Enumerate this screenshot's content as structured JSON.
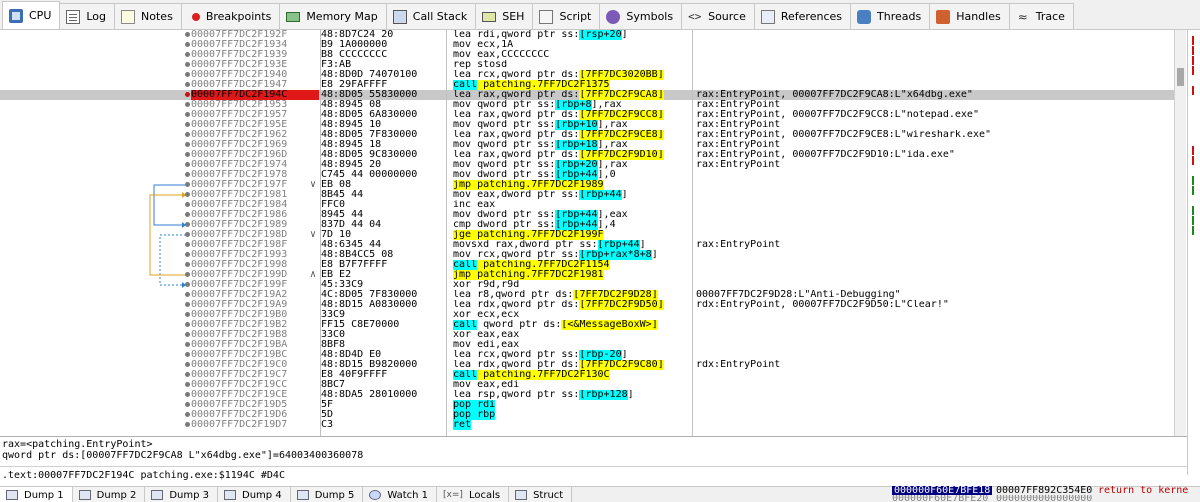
{
  "top_tabs": [
    {
      "label": "CPU",
      "icon": "cpu-icon"
    },
    {
      "label": "Log",
      "icon": "log-icon"
    },
    {
      "label": "Notes",
      "icon": "notes-icon"
    },
    {
      "label": "Breakpoints",
      "icon": "breakpoint-dot-icon"
    },
    {
      "label": "Memory Map",
      "icon": "memory-map-icon"
    },
    {
      "label": "Call Stack",
      "icon": "call-stack-icon"
    },
    {
      "label": "SEH",
      "icon": "seh-icon"
    },
    {
      "label": "Script",
      "icon": "script-icon"
    },
    {
      "label": "Symbols",
      "icon": "symbols-icon"
    },
    {
      "label": "Source",
      "icon": "source-icon"
    },
    {
      "label": "References",
      "icon": "references-icon"
    },
    {
      "label": "Threads",
      "icon": "threads-icon"
    },
    {
      "label": "Handles",
      "icon": "handles-icon"
    },
    {
      "label": "Trace",
      "icon": "trace-icon"
    }
  ],
  "active_top_tab": "CPU",
  "colors": {
    "breakpoint": "#e01818",
    "highlight_call_jump": "#ffff00",
    "highlight_memory": "#00ffff",
    "selected_row": "#c8c8c8",
    "stack_selected": "#000080",
    "return_text": "#c00000"
  },
  "disasm_rows": [
    {
      "addr": "00007FF7DC2F192F",
      "bytes": "48:8D7C24 20",
      "arrow": "",
      "instr": [
        [
          "lea rdi,qword ptr ss:",
          ""
        ],
        [
          "[",
          "c"
        ],
        [
          "rsp+20",
          "c"
        ],
        [
          "]",
          ""
        ]
      ],
      "comment": ""
    },
    {
      "addr": "00007FF7DC2F1934",
      "bytes": "B9 1A000000",
      "arrow": "",
      "instr": [
        [
          "mov ecx,1A",
          ""
        ]
      ],
      "comment": ""
    },
    {
      "addr": "00007FF7DC2F1939",
      "bytes": "B8 CCCCCCCC",
      "arrow": "",
      "instr": [
        [
          "mov eax,CCCCCCCC",
          ""
        ]
      ],
      "comment": ""
    },
    {
      "addr": "00007FF7DC2F193E",
      "bytes": "F3:AB",
      "arrow": "",
      "instr": [
        [
          "rep stosd",
          ""
        ]
      ],
      "comment": ""
    },
    {
      "addr": "00007FF7DC2F1940",
      "bytes": "48:8D0D 74070100",
      "arrow": "",
      "instr": [
        [
          "lea rcx,qword ptr ds:",
          ""
        ],
        [
          "[7FF7DC3020BB]",
          "y"
        ]
      ],
      "comment": ""
    },
    {
      "addr": "00007FF7DC2F1947",
      "bytes": "E8 29FAFFFF",
      "arrow": "",
      "instr": [
        [
          "call",
          "c"
        ],
        [
          " patching.7FF7DC2F1375",
          "y"
        ]
      ],
      "comment": ""
    },
    {
      "addr": "00007FF7DC2F194C",
      "bytes": "48:8D05 55830000",
      "arrow": "",
      "instr": [
        [
          "lea rax,qword ptr ds:",
          ""
        ],
        [
          "[7FF7DC2F9CA8]",
          "y"
        ]
      ],
      "comment": "rax:EntryPoint, 00007FF7DC2F9CA8:L\"x64dbg.exe\"",
      "bp": true,
      "selected": true
    },
    {
      "addr": "00007FF7DC2F1953",
      "bytes": "48:8945 08",
      "arrow": "",
      "instr": [
        [
          "mov qword ptr ss:",
          ""
        ],
        [
          "[",
          "c"
        ],
        [
          "rbp+8",
          "c"
        ],
        [
          "]",
          ""
        ],
        [
          ",rax",
          ""
        ]
      ],
      "comment": "rax:EntryPoint"
    },
    {
      "addr": "00007FF7DC2F1957",
      "bytes": "48:8D05 6A830000",
      "arrow": "",
      "instr": [
        [
          "lea rax,qword ptr ds:",
          ""
        ],
        [
          "[7FF7DC2F9CC8]",
          "y"
        ]
      ],
      "comment": "rax:EntryPoint, 00007FF7DC2F9CC8:L\"notepad.exe\""
    },
    {
      "addr": "00007FF7DC2F195E",
      "bytes": "48:8945 10",
      "arrow": "",
      "instr": [
        [
          "mov qword ptr ss:",
          ""
        ],
        [
          "[",
          "c"
        ],
        [
          "rbp+10",
          "c"
        ],
        [
          "]",
          ""
        ],
        [
          ",rax",
          ""
        ]
      ],
      "comment": "rax:EntryPoint"
    },
    {
      "addr": "00007FF7DC2F1962",
      "bytes": "48:8D05 7F830000",
      "arrow": "",
      "instr": [
        [
          "lea rax,qword ptr ds:",
          ""
        ],
        [
          "[7FF7DC2F9CE8]",
          "y"
        ]
      ],
      "comment": "rax:EntryPoint, 00007FF7DC2F9CE8:L\"wireshark.exe\""
    },
    {
      "addr": "00007FF7DC2F1969",
      "bytes": "48:8945 18",
      "arrow": "",
      "instr": [
        [
          "mov qword ptr ss:",
          ""
        ],
        [
          "[",
          "c"
        ],
        [
          "rbp+18",
          "c"
        ],
        [
          "]",
          ""
        ],
        [
          ",rax",
          ""
        ]
      ],
      "comment": "rax:EntryPoint"
    },
    {
      "addr": "00007FF7DC2F196D",
      "bytes": "48:8D05 9C830000",
      "arrow": "",
      "instr": [
        [
          "lea rax,qword ptr ds:",
          ""
        ],
        [
          "[7FF7DC2F9D10]",
          "y"
        ]
      ],
      "comment": "rax:EntryPoint, 00007FF7DC2F9D10:L\"ida.exe\""
    },
    {
      "addr": "00007FF7DC2F1974",
      "bytes": "48:8945 20",
      "arrow": "",
      "instr": [
        [
          "mov qword ptr ss:",
          ""
        ],
        [
          "[",
          "c"
        ],
        [
          "rbp+20",
          "c"
        ],
        [
          "]",
          ""
        ],
        [
          ",rax",
          ""
        ]
      ],
      "comment": "rax:EntryPoint"
    },
    {
      "addr": "00007FF7DC2F1978",
      "bytes": "C745 44 00000000",
      "arrow": "",
      "instr": [
        [
          "mov dword ptr ss:",
          ""
        ],
        [
          "[",
          "c"
        ],
        [
          "rbp+44",
          "c"
        ],
        [
          "]",
          ""
        ],
        [
          ",0",
          ""
        ]
      ],
      "comment": ""
    },
    {
      "addr": "00007FF7DC2F197F",
      "bytes": "EB 08",
      "arrow": "∨",
      "instr": [
        [
          "jmp patching.7FF7DC2F1989",
          "y"
        ]
      ],
      "comment": ""
    },
    {
      "addr": "00007FF7DC2F1981",
      "bytes": "8B45 44",
      "arrow": "",
      "instr": [
        [
          "mov eax,dword ptr ss:",
          ""
        ],
        [
          "[",
          "c"
        ],
        [
          "rbp+44",
          "c"
        ],
        [
          "]",
          ""
        ]
      ],
      "comment": ""
    },
    {
      "addr": "00007FF7DC2F1984",
      "bytes": "FFC0",
      "arrow": "",
      "instr": [
        [
          "inc eax",
          ""
        ]
      ],
      "comment": ""
    },
    {
      "addr": "00007FF7DC2F1986",
      "bytes": "8945 44",
      "arrow": "",
      "instr": [
        [
          "mov dword ptr ss:",
          ""
        ],
        [
          "[",
          "c"
        ],
        [
          "rbp+44",
          "c"
        ],
        [
          "]",
          ""
        ],
        [
          ",eax",
          ""
        ]
      ],
      "comment": ""
    },
    {
      "addr": "00007FF7DC2F1989",
      "bytes": "837D 44 04",
      "arrow": "",
      "instr": [
        [
          "cmp dword ptr ss:",
          ""
        ],
        [
          "[",
          "c"
        ],
        [
          "rbp+44",
          "c"
        ],
        [
          "]",
          ""
        ],
        [
          ",4",
          ""
        ]
      ],
      "comment": ""
    },
    {
      "addr": "00007FF7DC2F198D",
      "bytes": "7D 10",
      "arrow": "∨",
      "instr": [
        [
          "jge patching.7FF7DC2F199F",
          "y"
        ]
      ],
      "comment": ""
    },
    {
      "addr": "00007FF7DC2F198F",
      "bytes": "48:6345 44",
      "arrow": "",
      "instr": [
        [
          "movsxd rax,dword ptr ss:",
          ""
        ],
        [
          "[",
          "c"
        ],
        [
          "rbp+44",
          "c"
        ],
        [
          "]",
          ""
        ]
      ],
      "comment": "rax:EntryPoint"
    },
    {
      "addr": "00007FF7DC2F1993",
      "bytes": "48:8B4CC5 08",
      "arrow": "",
      "instr": [
        [
          "mov rcx,qword ptr ss:",
          ""
        ],
        [
          "[",
          "c"
        ],
        [
          "rbp+rax*8+8",
          "c"
        ],
        [
          "]",
          ""
        ]
      ],
      "comment": ""
    },
    {
      "addr": "00007FF7DC2F1998",
      "bytes": "E8 B7F7FFFF",
      "arrow": "",
      "instr": [
        [
          "call",
          "c"
        ],
        [
          " patching.7FF7DC2F1154",
          "y"
        ]
      ],
      "comment": ""
    },
    {
      "addr": "00007FF7DC2F199D",
      "bytes": "EB E2",
      "arrow": "∧",
      "instr": [
        [
          "jmp patching.7FF7DC2F1981",
          "y"
        ]
      ],
      "comment": ""
    },
    {
      "addr": "00007FF7DC2F199F",
      "bytes": "45:33C9",
      "arrow": "",
      "instr": [
        [
          "xor r9d,r9d",
          ""
        ]
      ],
      "comment": ""
    },
    {
      "addr": "00007FF7DC2F19A2",
      "bytes": "4C:8D05 7F830000",
      "arrow": "",
      "instr": [
        [
          "lea r8,qword ptr ds:",
          ""
        ],
        [
          "[7FF7DC2F9D28]",
          "y"
        ]
      ],
      "comment": "00007FF7DC2F9D28:L\"Anti-Debugging\""
    },
    {
      "addr": "00007FF7DC2F19A9",
      "bytes": "48:8D15 A0830000",
      "arrow": "",
      "instr": [
        [
          "lea rdx,qword ptr ds:",
          ""
        ],
        [
          "[7FF7DC2F9D50]",
          "y"
        ]
      ],
      "comment": "rdx:EntryPoint, 00007FF7DC2F9D50:L\"Clear!\""
    },
    {
      "addr": "00007FF7DC2F19B0",
      "bytes": "33C9",
      "arrow": "",
      "instr": [
        [
          "xor ecx,ecx",
          ""
        ]
      ],
      "comment": ""
    },
    {
      "addr": "00007FF7DC2F19B2",
      "bytes": "FF15 C8E70000",
      "arrow": "",
      "instr": [
        [
          "call",
          "c"
        ],
        [
          " qword ptr ds:",
          ""
        ],
        [
          "[<&MessageBoxW>]",
          "y"
        ]
      ],
      "comment": ""
    },
    {
      "addr": "00007FF7DC2F19B8",
      "bytes": "33C0",
      "arrow": "",
      "instr": [
        [
          "xor eax,eax",
          ""
        ]
      ],
      "comment": ""
    },
    {
      "addr": "00007FF7DC2F19BA",
      "bytes": "8BF8",
      "arrow": "",
      "instr": [
        [
          "mov edi,eax",
          ""
        ]
      ],
      "comment": ""
    },
    {
      "addr": "00007FF7DC2F19BC",
      "bytes": "48:8D4D E0",
      "arrow": "",
      "instr": [
        [
          "lea rcx,qword ptr ss:",
          ""
        ],
        [
          "[",
          "c"
        ],
        [
          "rbp-20",
          "c"
        ],
        [
          "]",
          ""
        ]
      ],
      "comment": ""
    },
    {
      "addr": "00007FF7DC2F19C0",
      "bytes": "48:8D15 B9820000",
      "arrow": "",
      "instr": [
        [
          "lea rdx,qword ptr ds:",
          ""
        ],
        [
          "[7FF7DC2F9C80]",
          "y"
        ]
      ],
      "comment": "rdx:EntryPoint"
    },
    {
      "addr": "00007FF7DC2F19C7",
      "bytes": "E8 40F9FFFF",
      "arrow": "",
      "instr": [
        [
          "call",
          "c"
        ],
        [
          " patching.7FF7DC2F130C",
          "y"
        ]
      ],
      "comment": ""
    },
    {
      "addr": "00007FF7DC2F19CC",
      "bytes": "8BC7",
      "arrow": "",
      "instr": [
        [
          "mov eax,edi",
          ""
        ]
      ],
      "comment": ""
    },
    {
      "addr": "00007FF7DC2F19CE",
      "bytes": "48:8DA5 28010000",
      "arrow": "",
      "instr": [
        [
          "lea rsp,qword ptr ss:",
          ""
        ],
        [
          "[",
          "c"
        ],
        [
          "rbp+128",
          "c"
        ],
        [
          "]",
          ""
        ]
      ],
      "comment": ""
    },
    {
      "addr": "00007FF7DC2F19D5",
      "bytes": "5F",
      "arrow": "",
      "instr": [
        [
          "pop rdi",
          "c"
        ]
      ],
      "comment": ""
    },
    {
      "addr": "00007FF7DC2F19D6",
      "bytes": "5D",
      "arrow": "",
      "instr": [
        [
          "pop rbp",
          "c"
        ]
      ],
      "comment": ""
    },
    {
      "addr": "00007FF7DC2F19D7",
      "bytes": "C3",
      "arrow": "",
      "instr": [
        [
          "ret",
          "c"
        ]
      ],
      "comment": ""
    }
  ],
  "info": {
    "line1": "rax=<patching.EntryPoint>",
    "line2": "qword ptr ds:[00007FF7DC2F9CA8 L\"x64dbg.exe\"]=64003400360078",
    "address_line": ".text:00007FF7DC2F194C patching.exe:$1194C #D4C"
  },
  "bottom_tabs": [
    {
      "label": "Dump 1",
      "icon": "dump-icon"
    },
    {
      "label": "Dump 2",
      "icon": "dump-icon"
    },
    {
      "label": "Dump 3",
      "icon": "dump-icon"
    },
    {
      "label": "Dump 4",
      "icon": "dump-icon"
    },
    {
      "label": "Dump 5",
      "icon": "dump-icon"
    },
    {
      "label": "Watch 1",
      "icon": "watch-eye-icon"
    },
    {
      "label": "Locals",
      "icon": "locals-icon"
    },
    {
      "label": "Struct",
      "icon": "struct-icon"
    }
  ],
  "active_bottom_tab": "Dump 1",
  "locals_icon_text": "[x=]",
  "stack": {
    "selected_addr": "000000F60E7BFE18",
    "value": "00007FF892C354E0",
    "comment": "return to kerne",
    "next_addr": "000000F60E7BFE20",
    "next_value": "0000000000000000"
  },
  "right_panel_marks": [
    {
      "row": 0,
      "color": "#d01010"
    },
    {
      "row": 1,
      "color": "#d01010"
    },
    {
      "row": 2,
      "color": "#d01010"
    },
    {
      "row": 3,
      "color": "#d01010"
    },
    {
      "row": 5,
      "color": "#d01010"
    },
    {
      "row": 11,
      "color": "#d01010"
    },
    {
      "row": 12,
      "color": "#d01010"
    },
    {
      "row": 14,
      "color": "#1a8a1a"
    },
    {
      "row": 15,
      "color": "#1a8a1a"
    },
    {
      "row": 17,
      "color": "#1a8a1a"
    },
    {
      "row": 18,
      "color": "#1a8a1a"
    },
    {
      "row": 19,
      "color": "#1a8a1a"
    }
  ]
}
